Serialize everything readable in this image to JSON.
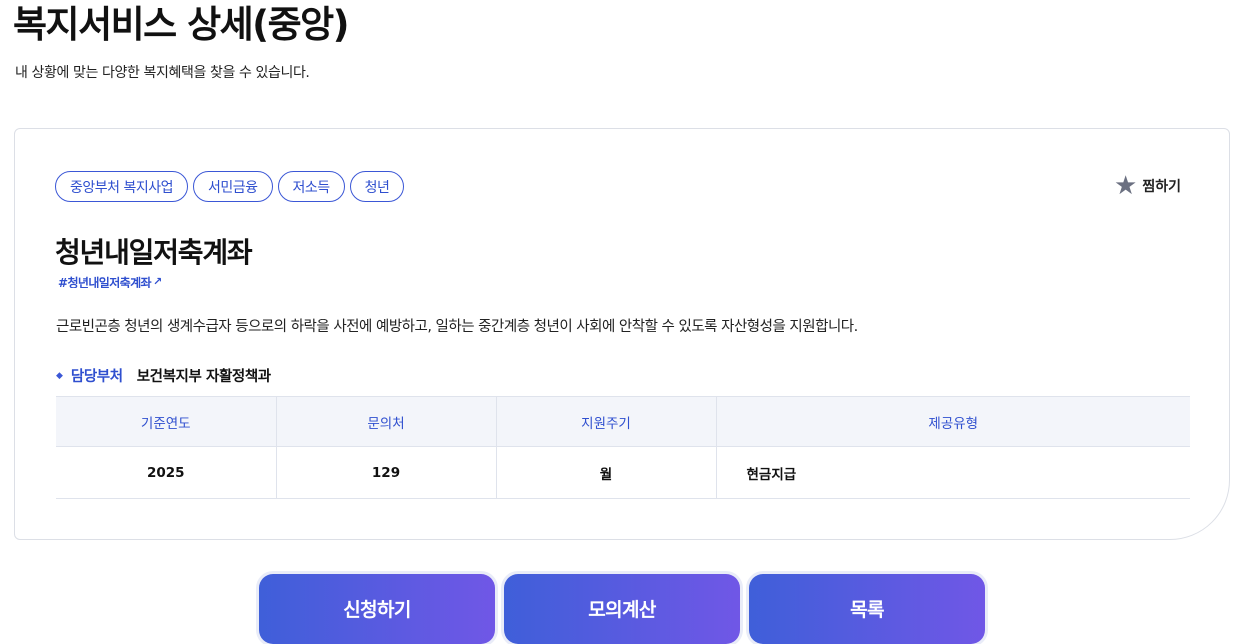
{
  "page": {
    "title": "복지서비스 상세(중앙)",
    "subtitle": "내 상황에 맞는 다양한 복지혜택을 찾을 수 있습니다."
  },
  "service": {
    "tags": [
      "중앙부처 복지사업",
      "서민금융",
      "저소득",
      "청년"
    ],
    "favorite_label": "찜하기",
    "title": "청년내일저축계좌",
    "hashtag": "#청년내일저축계좌",
    "description": "근로빈곤층 청년의 생계수급자 등으로의 하락을 사전에 예방하고, 일하는 중간계층 청년이 사회에 안착할 수 있도록 자산형성을 지원합니다.",
    "department_label": "담당부처",
    "department_value": "보건복지부 자활정책과"
  },
  "table": {
    "headers": [
      "기준연도",
      "문의처",
      "지원주기",
      "제공유형"
    ],
    "row": [
      "2025",
      "129",
      "월",
      "현금지급"
    ]
  },
  "actions": {
    "apply_label": "신청하기",
    "simulate_label": "모의계산",
    "list_label": "목록"
  },
  "icons": {
    "favorite": "star-icon",
    "hashtag_link": "external-link-icon",
    "department_bullet": "diamond-bullet-icon"
  },
  "colors": {
    "accent": "#2f4fcf",
    "button_gradient_start": "#3f5fd9",
    "button_gradient_end": "#7057e6"
  }
}
